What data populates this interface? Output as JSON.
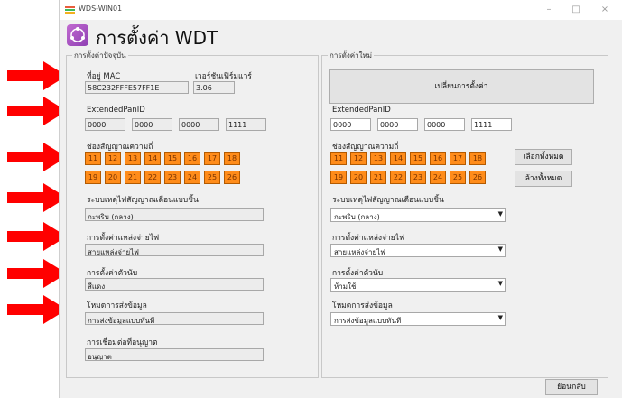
{
  "window": {
    "title": "WDS-WIN01",
    "controls": {
      "minimize": "–",
      "maximize": "□",
      "close": "×"
    }
  },
  "header": {
    "title": "การตั้งค่า WDT",
    "icon": "purple-network-icon"
  },
  "current": {
    "legend": "การตั้งค่าปัจจุบัน",
    "mac_label": "ที่อยู่ MAC",
    "mac_value": "58C232FFFE57FF1E",
    "fw_label": "เวอร์ชันเฟิร์มแวร์",
    "fw_value": "3.06",
    "panid_label": "ExtendedPanID",
    "panid": [
      "0000",
      "0000",
      "0000",
      "1111"
    ],
    "channel_label": "ช่องสัญญาณความถี่",
    "channels_row1": [
      "11",
      "12",
      "13",
      "14",
      "15",
      "16",
      "17",
      "18"
    ],
    "channels_row2": [
      "19",
      "20",
      "21",
      "22",
      "23",
      "24",
      "25",
      "26"
    ],
    "alarm_label": "ระบบเหตุไฟสัญญาณเตือนแบบชิ้น",
    "alarm_value": "กะพริบ (กลาง)",
    "power_label": "การตั้งค่าแหล่งจ่ายไฟ",
    "power_value": "สายแหล่งจ่ายไฟ",
    "counter_label": "การตั้งค่าตัวนับ",
    "counter_value": "สีแดง",
    "transmit_label": "โหมดการส่งข้อมูล",
    "transmit_value": "การส่งข้อมูลแบบทันที",
    "permit_label": "การเชื่อมต่อที่อนุญาต",
    "permit_value": "อนุญาต"
  },
  "new": {
    "legend": "การตั้งค่าใหม่",
    "apply_button": "เปลี่ยนการตั้งค่า",
    "panid_label": "ExtendedPanID",
    "panid": [
      "0000",
      "0000",
      "0000",
      "1111"
    ],
    "channel_label": "ช่องสัญญาณความถี่",
    "channels_row1": [
      "11",
      "12",
      "13",
      "14",
      "15",
      "16",
      "17",
      "18"
    ],
    "channels_row2": [
      "19",
      "20",
      "21",
      "22",
      "23",
      "24",
      "25",
      "26"
    ],
    "select_all": "เลือกทั้งหมด",
    "clear_all": "ล้างทั้งหมด",
    "alarm_label": "ระบบเหตุไฟสัญญาณเตือนแบบชิ้น",
    "alarm_value": "กะพริบ (กลาง)",
    "power_label": "การตั้งค่าแหล่งจ่ายไฟ",
    "power_value": "สายแหล่งจ่ายไฟ",
    "counter_label": "การตั้งค่าตัวนับ",
    "counter_value": "ห้ามใช้",
    "transmit_label": "โหมดการส่งข้อมูล",
    "transmit_value": "การส่งข้อมูลแบบทันที"
  },
  "footer": {
    "back_button": "ย้อนกลับ"
  },
  "colors": {
    "arrow": "#ff0000",
    "channel": "#ff8c1a",
    "channel_border": "#b35a00"
  }
}
